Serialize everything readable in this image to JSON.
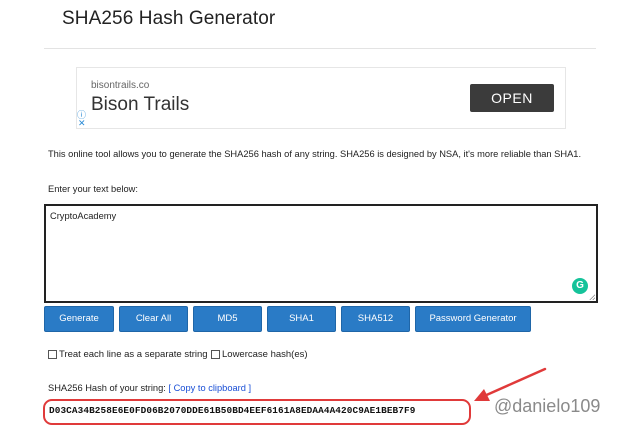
{
  "page": {
    "title": "SHA256 Hash Generator"
  },
  "ad": {
    "domain": "bisontrails.co",
    "brand": "Bison Trails",
    "cta": "OPEN"
  },
  "description": "This online tool allows you to generate the SHA256 hash of any string. SHA256 is designed by NSA, it's more reliable than SHA1.",
  "input": {
    "prompt": "Enter your text below:",
    "value": "CryptoAcademy"
  },
  "buttons": {
    "generate": "Generate",
    "clear_all": "Clear All",
    "md5": "MD5",
    "sha1": "SHA1",
    "sha512": "SHA512",
    "password_generator": "Password Generator"
  },
  "options": {
    "treat_each_line": "Treat each line as a separate string",
    "lowercase": "Lowercase hash(es)"
  },
  "result": {
    "label": "SHA256 Hash of your string:",
    "copy_link": "[ Copy to clipboard ]",
    "hash": "D03CA34B258E6E0FD06B2070DDE61B50BD4EEF6161A8EDAA4A420C9AE1BEB7F9"
  },
  "annotation": {
    "watermark": "@danielo109",
    "highlight_color": "#e03a3a"
  }
}
